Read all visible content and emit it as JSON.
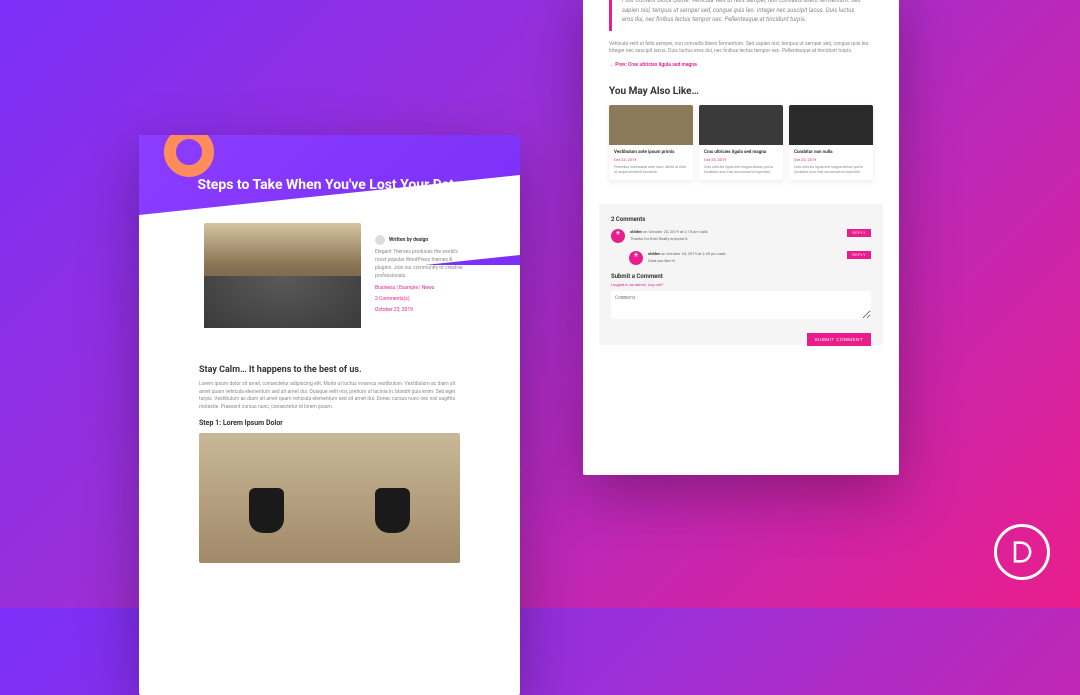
{
  "left": {
    "hero_title": "Steps to Take When You've Lost Your Data",
    "meta": {
      "author": "Written by design",
      "desc": "Elegant Themes produces the world's most popular WordPress themes & plugins. Join our community of creative professionals.",
      "categories": "Business | Example | News",
      "comments": "2 Comments(s)",
      "date": "October 23, 2019"
    },
    "content": {
      "h2": "Stay Calm… It happens to the best of us.",
      "p1": "Lorem ipsum dolor sit amet, consectetur adipiscing elit. Morbi ut luctus vivamus vestibulum. Vestibulum ac diam sit amet quam vehicula elementum sed sit amet dui. Quisque velit nisi, pretium ut lacinia in, blandit quis enim. Sed eget turpis. Vestibulum ac diam sit amet quam vehicula elementum sed sit amet dui. Donec cursus nunc nec nisl sagittis molestie. Praesent cursus nunc, consectetur id lorem ipsum.",
      "h3": "Step 1: Lorem Ipsum Dolor"
    }
  },
  "right": {
    "quote": "Post Content Block Quote. Vehicula velit ut felis semper, non convallis libero fermentum. Sed sapien nisl, tempus ut semper sed, congue quis leo. Integer nec suscipit lacus. Duis luctus eros dui, nec finibus lectus tempor nec. Pellentesque at tincidunt turpis.",
    "after_quote": "Vehicula velit ut felis semper, non convallis libero fermentum. Sed sapien nisl, tempus ut semper sed, congue quis leo. Integer nec suscipit lacus. Duis luctus eros dui, nec finibus lectus tempor nec. Pellentesque at tincidunt turpis.",
    "prev_link": "← Prev: Cras ultricies ligula sed magna",
    "related_h": "You May Also Like…",
    "tiles": [
      {
        "title": "Vestibulum ante ipsum primis",
        "date": "Oct 23, 2019",
        "text": "Phasellus malesuada ante nunc. Morbi ut nibh et neque hendrerit tincidunt."
      },
      {
        "title": "Cras ultricies ligula sed magna",
        "date": "Oct 23, 2019",
        "text": "Cras ultricies ligula sed magna dictum porta. Curabitur arcu erat, accumsan id imperdiet."
      },
      {
        "title": "Curabitur non nulla",
        "date": "Oct 23, 2019",
        "text": "Cras ultricies ligula sed magna dictum porta. Curabitur arcu erat, accumsan id imperdiet."
      }
    ],
    "comments": {
      "heading": "2 Comments",
      "items": [
        {
          "name": "olddev",
          "meta": " on October 23, 2019 at 2:15 pm said:",
          "text": "Thanks for this! Really enjoyed it."
        },
        {
          "name": "olddev",
          "meta": " on October 23, 2019 at 2:45 pm said:",
          "text": "Glad you like it!"
        }
      ],
      "reply": "REPLY",
      "form_h": "Submit a Comment",
      "form_note": "Logged in as admin. Log out?",
      "placeholder": "Comment",
      "submit": "SUBMIT COMMENT"
    }
  }
}
